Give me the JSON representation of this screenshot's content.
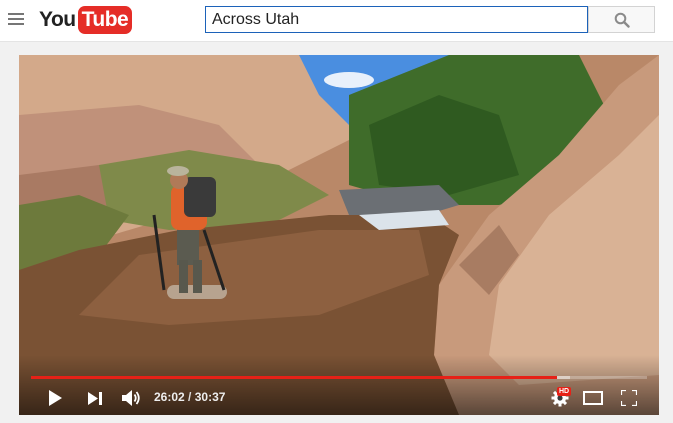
{
  "masthead": {
    "logo": {
      "you": "You",
      "tube": "Tube"
    },
    "search": {
      "value": "Across Utah",
      "placeholder": "Search"
    },
    "icons": {
      "menu": "hamburger-menu-icon",
      "search": "search-icon"
    }
  },
  "player": {
    "progress": {
      "played_fraction": 0.854,
      "loaded_fraction": 0.875
    },
    "time": {
      "current": "26:02",
      "separator": " / ",
      "duration": "30:37"
    },
    "settings_badge": "HD",
    "icons": {
      "play": "play-icon",
      "next": "next-icon",
      "volume": "volume-icon",
      "settings": "gear-icon",
      "theater": "theater-mode-icon",
      "fullscreen": "fullscreen-icon"
    },
    "colors": {
      "progress": "#e62117",
      "brand": "#e52d27",
      "search_border": "#1c62b9"
    }
  }
}
